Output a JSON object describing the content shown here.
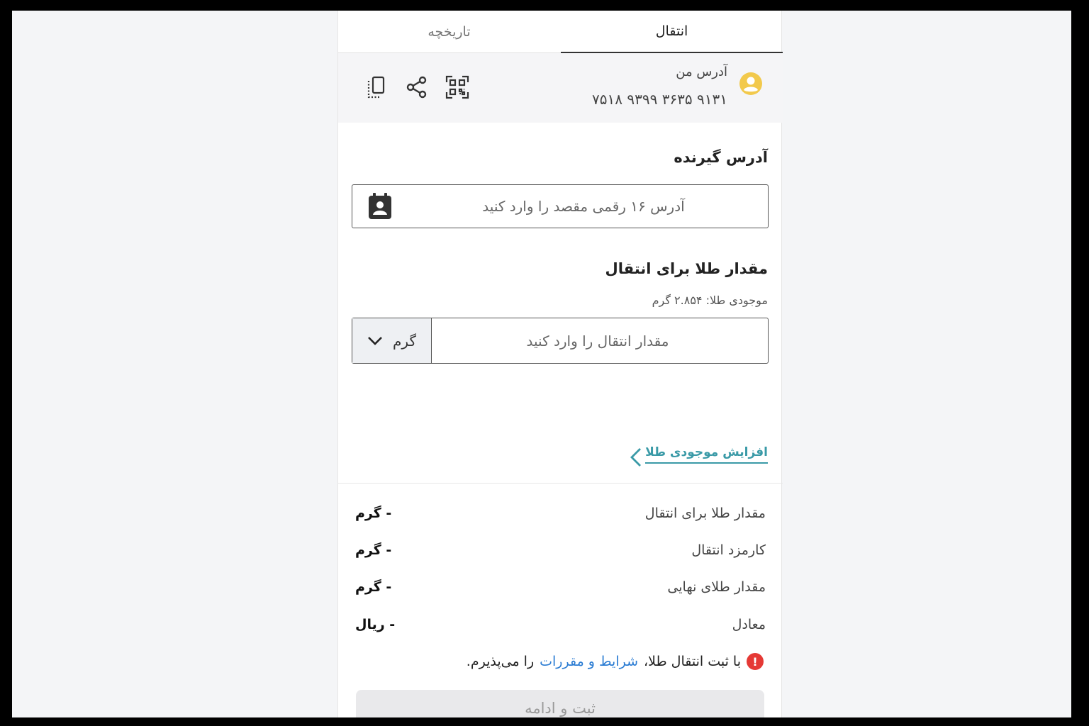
{
  "tabs": {
    "transfer": "انتقال",
    "history": "تاریخچه"
  },
  "my_address": {
    "label": "آدرس من",
    "value": "۷۵۱۸ ۹۳۹۹ ۳۶۳۵ ۹۱۳۱"
  },
  "recipient": {
    "title": "آدرس گیرنده",
    "placeholder": "آدرس ۱۶ رقمی مقصد را وارد کنید"
  },
  "amount": {
    "title": "مقدار طلا برای انتقال",
    "balance": "موجودی طلا: ۲.۸۵۴ گرم",
    "placeholder": "مقدار انتقال را وارد کنید",
    "unit": "گرم"
  },
  "increase_link": "افزایش موجودی طلا",
  "summary": [
    {
      "label": "مقدار طلا برای انتقال",
      "value": "- گرم"
    },
    {
      "label": "کارمزد انتقال",
      "value": "- گرم"
    },
    {
      "label": "مقدار طلای نهایی",
      "value": "- گرم"
    },
    {
      "label": "معادل",
      "value": "- ریال"
    }
  ],
  "terms": {
    "prefix": "با ثبت انتقال طلا،",
    "link": "شرایط و مقررات",
    "suffix": "را می‌پذیرم.",
    "alert_glyph": "!"
  },
  "submit_label": "ثبت و ادامه",
  "colors": {
    "accent_teal": "#3a9aa7",
    "link_blue": "#2b7cd3",
    "avatar_yellow": "#f2c94c",
    "alert_red": "#e53935"
  }
}
